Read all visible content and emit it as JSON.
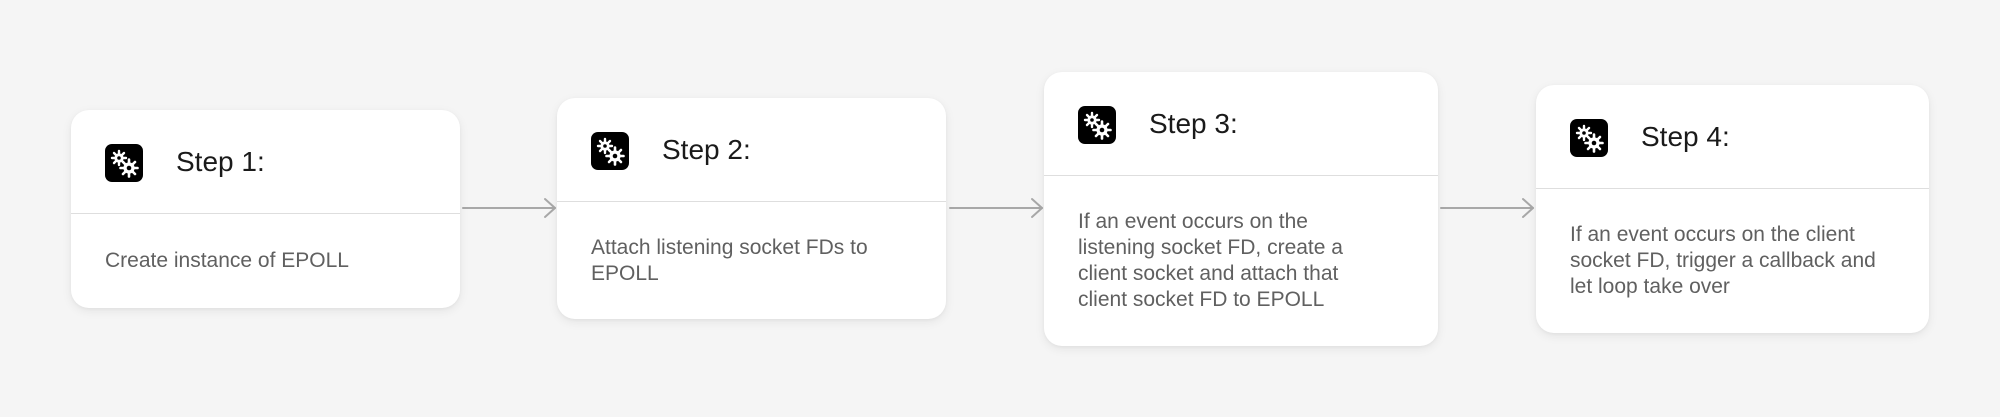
{
  "steps": [
    {
      "title": "Step 1:",
      "description": "Create instance of EPOLL"
    },
    {
      "title": "Step 2:",
      "description": "Attach listening socket FDs to EPOLL"
    },
    {
      "title": "Step 3:",
      "description": "If an event occurs on the listening socket FD, create a client socket and attach that client socket FD to EPOLL"
    },
    {
      "title": "Step 4:",
      "description": "If an event occurs on the client socket FD, trigger a callback and let loop take over"
    }
  ],
  "icons": {
    "step_icon": "gears-icon"
  },
  "colors": {
    "background": "#f5f5f5",
    "card": "#ffffff",
    "arrow": "#a8a8a8",
    "icon_bg": "#000000"
  }
}
